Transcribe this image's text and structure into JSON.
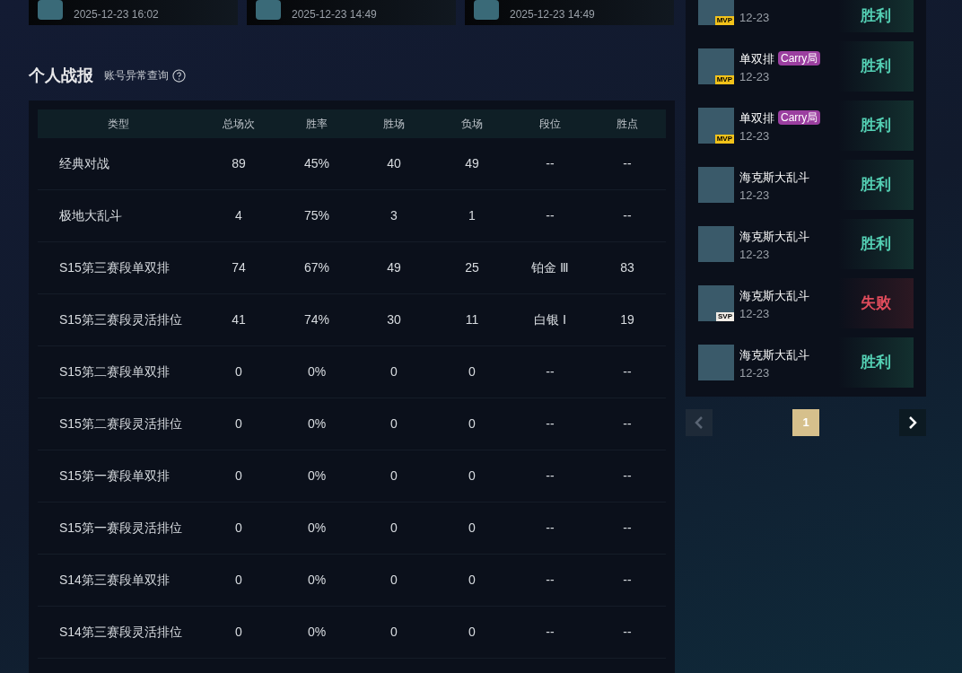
{
  "recent_cards": [
    {
      "date": "2025-12-23 16:02"
    },
    {
      "date": "2025-12-23 14:49"
    },
    {
      "date": "2025-12-23 14:49"
    }
  ],
  "stats": {
    "title": "个人战报",
    "link": "账号异常查询",
    "columns": [
      "类型",
      "总场次",
      "胜率",
      "胜场",
      "负场",
      "段位",
      "胜点"
    ],
    "rows": [
      [
        "经典对战",
        "89",
        "45%",
        "40",
        "49",
        "--",
        "--"
      ],
      [
        "极地大乱斗",
        "4",
        "75%",
        "3",
        "1",
        "--",
        "--"
      ],
      [
        "S15第三赛段单双排",
        "74",
        "67%",
        "49",
        "25",
        "铂金 Ⅲ",
        "83"
      ],
      [
        "S15第三赛段灵活排位",
        "41",
        "74%",
        "30",
        "11",
        "白银 Ⅰ",
        "19"
      ],
      [
        "S15第二赛段单双排",
        "0",
        "0%",
        "0",
        "0",
        "--",
        "--"
      ],
      [
        "S15第二赛段灵活排位",
        "0",
        "0%",
        "0",
        "0",
        "--",
        "--"
      ],
      [
        "S15第一赛段单双排",
        "0",
        "0%",
        "0",
        "0",
        "--",
        "--"
      ],
      [
        "S15第一赛段灵活排位",
        "0",
        "0%",
        "0",
        "0",
        "--",
        "--"
      ],
      [
        "S14第三赛段单双排",
        "0",
        "0%",
        "0",
        "0",
        "--",
        "--"
      ],
      [
        "S14第三赛段灵活排位",
        "0",
        "0%",
        "0",
        "0",
        "--",
        "--"
      ]
    ]
  },
  "matches": [
    {
      "date": "12-23",
      "badge": "MVP",
      "result": "胜利",
      "win": true
    },
    {
      "mode": "单双排",
      "tag": "Carry局",
      "date": "12-23",
      "badge": "MVP",
      "result": "胜利",
      "win": true
    },
    {
      "mode": "单双排",
      "tag": "Carry局",
      "date": "12-23",
      "badge": "MVP",
      "result": "胜利",
      "win": true
    },
    {
      "mode": "海克斯大乱斗",
      "date": "12-23",
      "result": "胜利",
      "win": true
    },
    {
      "mode": "海克斯大乱斗",
      "date": "12-23",
      "result": "胜利",
      "win": true
    },
    {
      "mode": "海克斯大乱斗",
      "date": "12-23",
      "badge": "SVP",
      "result": "失败",
      "win": false
    },
    {
      "mode": "海克斯大乱斗",
      "date": "12-23",
      "result": "胜利",
      "win": true
    }
  ],
  "pagination": {
    "prev_disabled": true,
    "pages": [
      {
        "label": "1",
        "selected": true
      }
    ],
    "next_disabled": false
  }
}
